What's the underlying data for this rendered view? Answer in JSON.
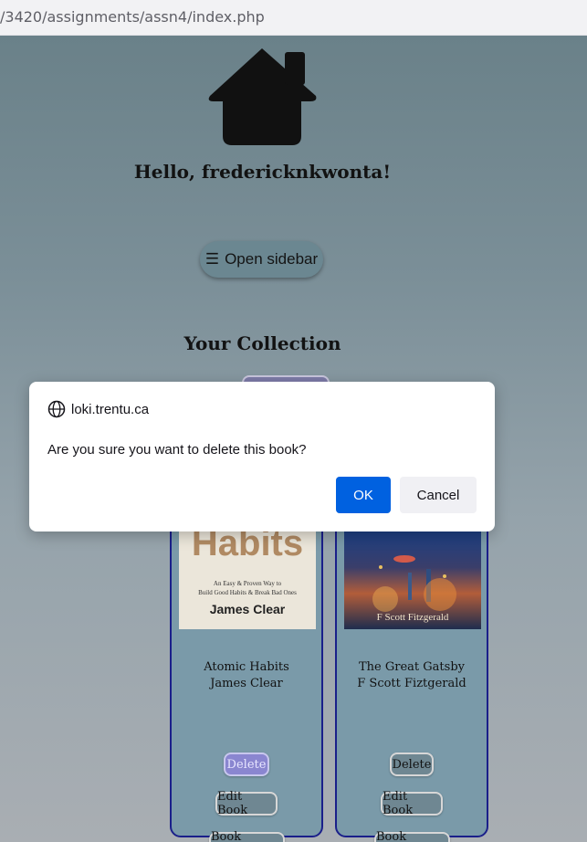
{
  "browser": {
    "url": "/3420/assignments/assn4/index.php"
  },
  "page": {
    "greeting": "Hello, fredericknkwonta!",
    "sidebar_button": {
      "icon": "hamburger-icon",
      "glyph": "☰",
      "label": "Open sidebar"
    },
    "collection_title": "Your Collection",
    "books": [
      {
        "title": "Atomic Habits",
        "author": "James Clear",
        "cover": {
          "headline": "Habits",
          "tagline_1": "An Easy & Proven Way to",
          "tagline_2": "Build Good Habits & Break Bad Ones",
          "author": "James Clear"
        },
        "delete_label": "Delete",
        "edit_label": "Edit Book",
        "details_label": "Book details"
      },
      {
        "title": "The Great Gatsby",
        "author": "F Scott Fiztgerald",
        "cover": {
          "author": "F Scott Fitzgerald"
        },
        "delete_label": "Delete",
        "edit_label": "Edit Book",
        "details_label": "Book details"
      }
    ]
  },
  "dialog": {
    "origin": "loki.trentu.ca",
    "origin_icon": "globe-icon",
    "message": "Are you sure you want to delete this book?",
    "ok_label": "OK",
    "cancel_label": "Cancel",
    "ok_color": "#0061e0"
  }
}
